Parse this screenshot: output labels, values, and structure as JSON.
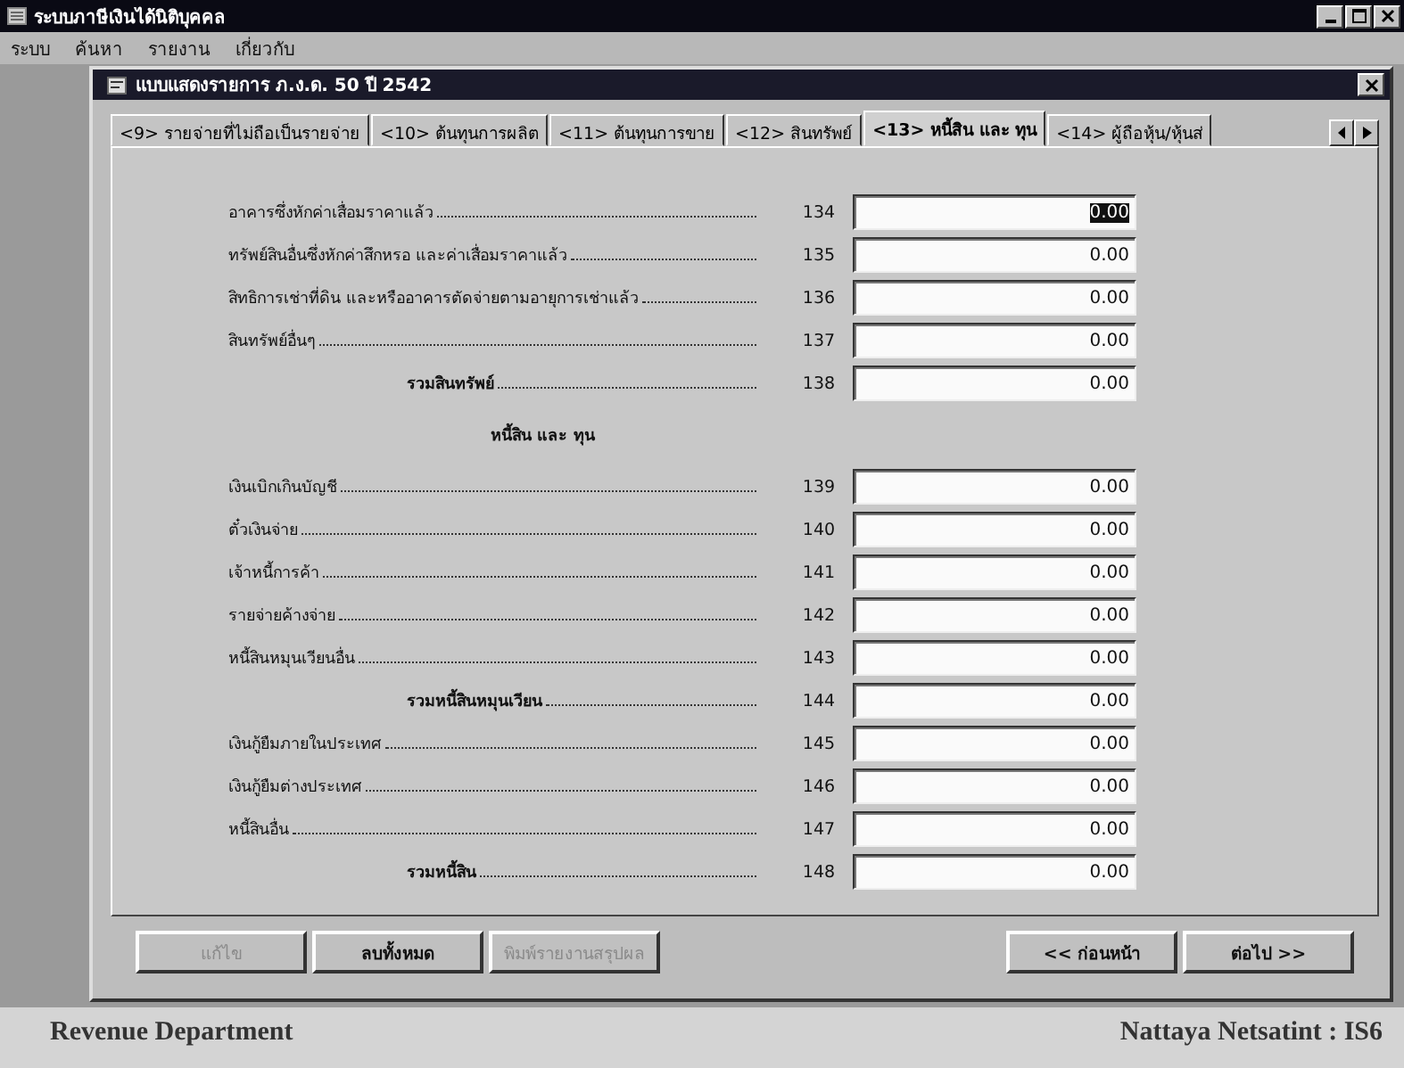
{
  "app_window": {
    "title": "ระบบภาษีเงินได้นิติบุคคล"
  },
  "menu": [
    "ระบบ",
    "ค้นหา",
    "รายงาน",
    "เกี่ยวกับ"
  ],
  "form_window": {
    "title": "แบบแสดงรายการ ภ.ง.ด. 50 ปี 2542"
  },
  "tabs": [
    {
      "label": "<9> รายจ่ายที่ไม่ถือเป็นรายจ่าย",
      "selected": false
    },
    {
      "label": "<10> ต้นทุนการผลิต",
      "selected": false
    },
    {
      "label": "<11> ต้นทุนการขาย",
      "selected": false
    },
    {
      "label": "<12> สินทรัพย์",
      "selected": false
    },
    {
      "label": "<13> หนี้สิน และ ทุน",
      "selected": true
    },
    {
      "label": "<14> ผู้ถือหุ้น/หุ้นส่",
      "selected": false
    }
  ],
  "rows": [
    {
      "kind": "item",
      "label": "อาคารซึ่งหักค่าเสื่อมราคาแล้ว",
      "line": "134",
      "value": "0.00",
      "highlighted": true
    },
    {
      "kind": "item",
      "label": "ทรัพย์สินอื่นซึ่งหักค่าสึกหรอ และค่าเสื่อมราคาแล้ว",
      "line": "135",
      "value": "0.00",
      "highlighted": false
    },
    {
      "kind": "item",
      "label": "สิทธิการเช่าที่ดิน และหรืออาคารตัดจ่ายตามอายุการเช่าแล้ว",
      "line": "136",
      "value": "0.00",
      "highlighted": false
    },
    {
      "kind": "item",
      "label": "สินทรัพย์อื่นๆ",
      "line": "137",
      "value": "0.00",
      "highlighted": false
    },
    {
      "kind": "total",
      "label": "รวมสินทรัพย์",
      "line": "138",
      "value": "0.00",
      "highlighted": false
    },
    {
      "kind": "heading",
      "label": "หนี้สิน และ ทุน"
    },
    {
      "kind": "item",
      "label": "เงินเบิกเกินบัญชี",
      "line": "139",
      "value": "0.00",
      "highlighted": false
    },
    {
      "kind": "item",
      "label": "ตั๋วเงินจ่าย",
      "line": "140",
      "value": "0.00",
      "highlighted": false
    },
    {
      "kind": "item",
      "label": "เจ้าหนี้การค้า",
      "line": "141",
      "value": "0.00",
      "highlighted": false
    },
    {
      "kind": "item",
      "label": "รายจ่ายค้างจ่าย",
      "line": "142",
      "value": "0.00",
      "highlighted": false
    },
    {
      "kind": "item",
      "label": "หนี้สินหมุนเวียนอื่น",
      "line": "143",
      "value": "0.00",
      "highlighted": false
    },
    {
      "kind": "total",
      "label": "รวมหนี้สินหมุนเวียน",
      "line": "144",
      "value": "0.00",
      "highlighted": false
    },
    {
      "kind": "item",
      "label": "เงินกู้ยืมภายในประเทศ",
      "line": "145",
      "value": "0.00",
      "highlighted": false
    },
    {
      "kind": "item",
      "label": "เงินกู้ยืมต่างประเทศ",
      "line": "146",
      "value": "0.00",
      "highlighted": false
    },
    {
      "kind": "item",
      "label": "หนี้สินอื่น",
      "line": "147",
      "value": "0.00",
      "highlighted": false
    },
    {
      "kind": "total",
      "label": "รวมหนี้สิน",
      "line": "148",
      "value": "0.00",
      "highlighted": false
    }
  ],
  "buttons_left": [
    {
      "label": "แก้ไข",
      "disabled": true
    },
    {
      "label": "ลบทั้งหมด",
      "disabled": false
    },
    {
      "label": "พิมพ์รายงานสรุปผล",
      "disabled": true
    }
  ],
  "buttons_right": [
    {
      "label": "<< ก่อนหน้า",
      "disabled": false
    },
    {
      "label": "ต่อไป >>",
      "disabled": false
    }
  ],
  "footer": {
    "left": "Revenue Department",
    "right": "Nattaya Netsatint : IS6"
  }
}
